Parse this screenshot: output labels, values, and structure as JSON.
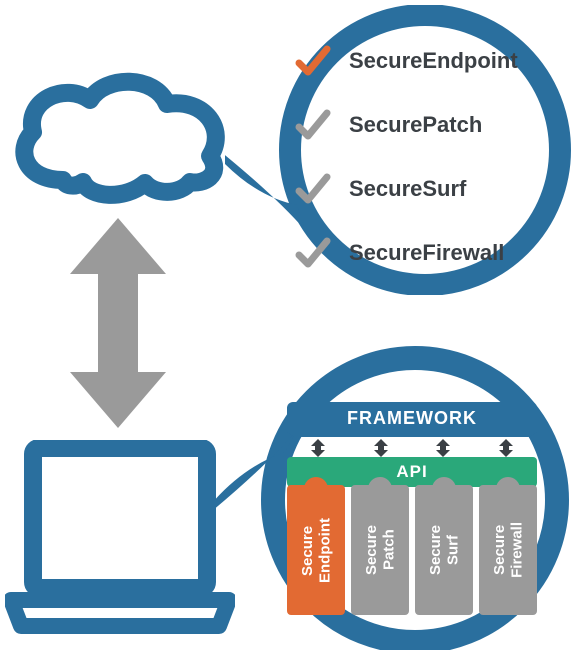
{
  "colors": {
    "blue": "#2a6f9e",
    "gray": "#9a9a9a",
    "orange": "#e26a33",
    "green": "#2aa87a",
    "text": "#3b4045"
  },
  "top_bubble": {
    "items": [
      {
        "label": "SecureEndpoint",
        "check_color": "orange"
      },
      {
        "label": "SecurePatch",
        "check_color": "gray"
      },
      {
        "label": "SecureSurf",
        "check_color": "gray"
      },
      {
        "label": "SecureFirewall",
        "check_color": "gray"
      }
    ]
  },
  "bottom_bubble": {
    "framework_label": "FRAMEWORK",
    "api_label": "API",
    "modules": [
      {
        "label": "Secure\nEndpoint",
        "color": "orange"
      },
      {
        "label": "Secure\nPatch",
        "color": "gray"
      },
      {
        "label": "Secure\nSurf",
        "color": "gray"
      },
      {
        "label": "Secure\nFirewall",
        "color": "gray"
      }
    ]
  }
}
